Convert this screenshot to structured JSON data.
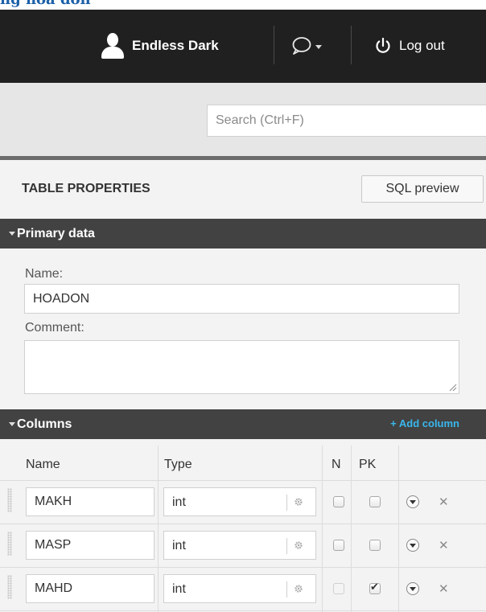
{
  "top_fragment_text": "ng hoá đơn",
  "topbar": {
    "user_name": "Endless Dark",
    "logout_label": "Log out"
  },
  "search": {
    "placeholder": "Search (Ctrl+F)"
  },
  "table_properties": {
    "title": "TABLE PROPERTIES",
    "sql_preview_label": "SQL preview"
  },
  "primary_data": {
    "section_title": "Primary data",
    "name_label": "Name:",
    "name_value": "HOADON",
    "comment_label": "Comment:",
    "comment_value": ""
  },
  "columns": {
    "section_title": "Columns",
    "add_column_label": "+ Add column",
    "headers": {
      "name": "Name",
      "type": "Type",
      "n": "N",
      "pk": "PK"
    },
    "rows": [
      {
        "name": "MAKH",
        "type": "int",
        "nullable": false,
        "pk": false,
        "nullable_disabled": false
      },
      {
        "name": "MASP",
        "type": "int",
        "nullable": false,
        "pk": false,
        "nullable_disabled": false
      },
      {
        "name": "MAHD",
        "type": "int",
        "nullable": false,
        "pk": true,
        "nullable_disabled": true
      }
    ]
  },
  "icons": {
    "user": "user-icon",
    "chat": "chat-bubble-icon",
    "logout": "power-icon",
    "gear": "gear-icon",
    "row_menu": "circle-chevron-down-icon",
    "delete": "close-icon"
  },
  "colors": {
    "topbar": "#202020",
    "section_bar": "#424242",
    "accent_link": "#39b7ec",
    "panel": "#f3f3f3"
  }
}
